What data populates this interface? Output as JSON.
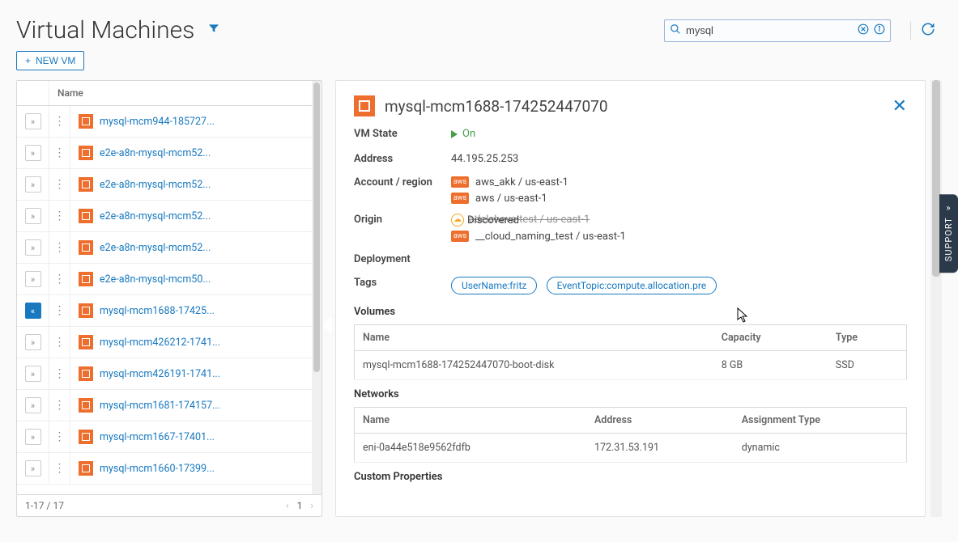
{
  "page_title": "Virtual Machines",
  "search": {
    "value": "mysql",
    "placeholder": ""
  },
  "new_vm_label": "NEW VM",
  "list": {
    "header_name": "Name",
    "rows": [
      {
        "name": "mysql-mcm944-185727..."
      },
      {
        "name": "e2e-a8n-mysql-mcm52..."
      },
      {
        "name": "e2e-a8n-mysql-mcm52..."
      },
      {
        "name": "e2e-a8n-mysql-mcm52..."
      },
      {
        "name": "e2e-a8n-mysql-mcm52..."
      },
      {
        "name": "e2e-a8n-mysql-mcm50..."
      },
      {
        "name": "mysql-mcm1688-17425...",
        "selected": true
      },
      {
        "name": "mysql-mcm426212-1741..."
      },
      {
        "name": "mysql-mcm426191-1741..."
      },
      {
        "name": "mysql-mcm1681-174157..."
      },
      {
        "name": "mysql-mcm1667-17401..."
      },
      {
        "name": "mysql-mcm1660-17399..."
      }
    ],
    "footer_range": "1-17 / 17",
    "page_num": "1"
  },
  "detail": {
    "title": "mysql-mcm1688-174252447070",
    "labels": {
      "vm_state": "VM State",
      "address": "Address",
      "account_region": "Account / region",
      "origin": "Origin",
      "deployment": "Deployment",
      "tags": "Tags",
      "volumes": "Volumes",
      "networks": "Networks",
      "custom_properties": "Custom Properties"
    },
    "vm_state": "On",
    "address": "44.195.25.253",
    "accounts": [
      "aws_akk / us-east-1",
      "aws / us-east-1",
      "adelcheva-test / us-east-1",
      "__cloud_naming_test / us-east-1"
    ],
    "origin": "Discovered",
    "tags": [
      "UserName:fritz",
      "EventTopic:compute.allocation.pre"
    ],
    "volumes": {
      "cols": {
        "name": "Name",
        "capacity": "Capacity",
        "type": "Type"
      },
      "rows": [
        {
          "name": "mysql-mcm1688-174252447070-boot-disk",
          "capacity": "8 GB",
          "type": "SSD"
        }
      ]
    },
    "networks": {
      "cols": {
        "name": "Name",
        "address": "Address",
        "assignment": "Assignment Type"
      },
      "rows": [
        {
          "name": "eni-0a44e518e9562fdfb",
          "address": "172.31.53.191",
          "assignment": "dynamic"
        }
      ]
    }
  },
  "support_label": "SUPPORT"
}
